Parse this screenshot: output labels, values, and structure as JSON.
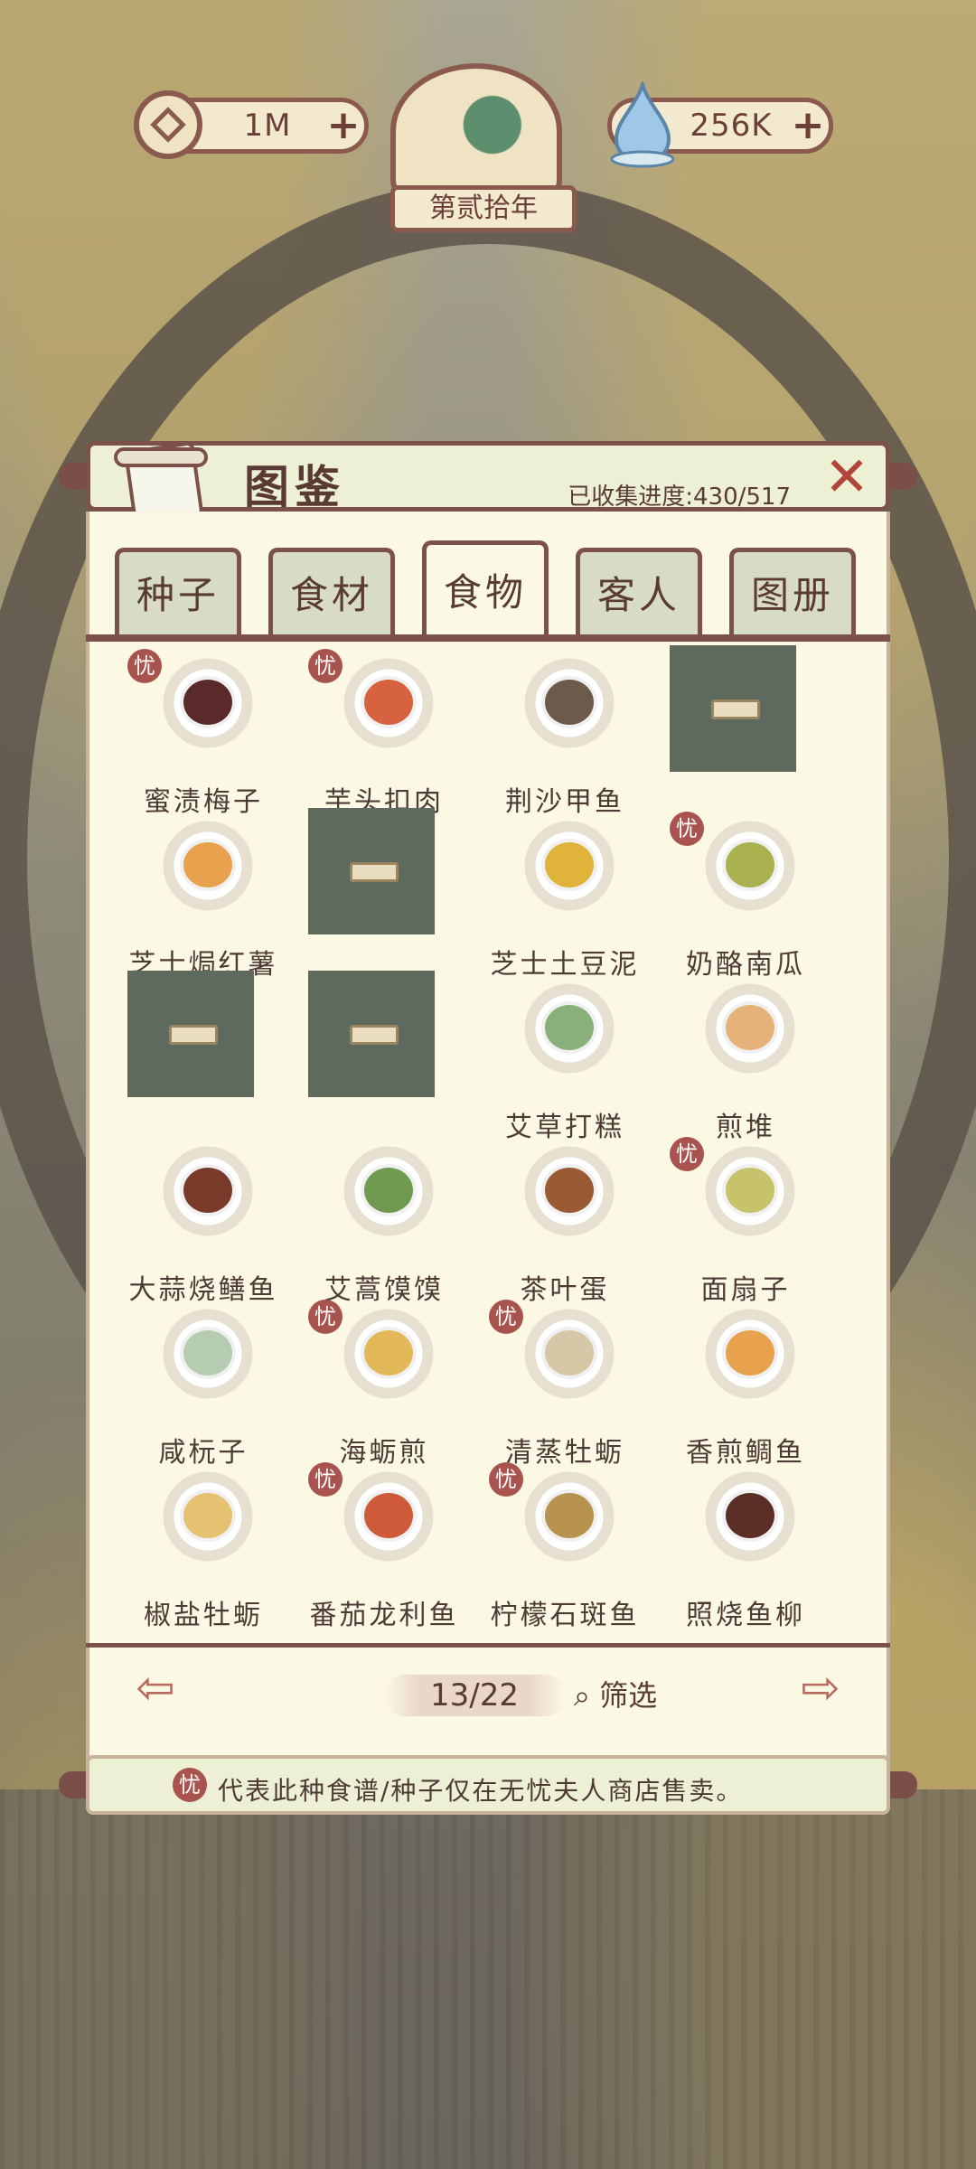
{
  "top": {
    "coins": "1M",
    "water": "256K",
    "year": "第贰拾年"
  },
  "panel": {
    "title": "图鉴",
    "progress": "已收集进度:430/517",
    "close_label": "✕"
  },
  "tabs": [
    {
      "label": "种子",
      "active": false
    },
    {
      "label": "食材",
      "active": false
    },
    {
      "label": "食物",
      "active": true
    },
    {
      "label": "客人",
      "active": false
    },
    {
      "label": "图册",
      "active": false
    }
  ],
  "badge_char": "忧",
  "items": [
    {
      "name": "蜜渍梅子",
      "locked": false,
      "badge": true,
      "color": "#5a2a2a"
    },
    {
      "name": "芋头扣肉",
      "locked": false,
      "badge": true,
      "color": "#d6623f"
    },
    {
      "name": "荆沙甲鱼",
      "locked": false,
      "badge": false,
      "color": "#6d5a4a"
    },
    {
      "name": "",
      "locked": true,
      "badge": false
    },
    {
      "name": "芝士焗红薯",
      "locked": false,
      "badge": false,
      "color": "#e8a24d"
    },
    {
      "name": "",
      "locked": true,
      "badge": false
    },
    {
      "name": "芝士土豆泥",
      "locked": false,
      "badge": false,
      "color": "#e0b43a"
    },
    {
      "name": "奶酪南瓜",
      "locked": false,
      "badge": true,
      "color": "#a9b24e"
    },
    {
      "name": "",
      "locked": true,
      "badge": false
    },
    {
      "name": "",
      "locked": true,
      "badge": false
    },
    {
      "name": "艾草打糕",
      "locked": false,
      "badge": false,
      "color": "#89b07a"
    },
    {
      "name": "煎堆",
      "locked": false,
      "badge": false,
      "color": "#e7b27a"
    },
    {
      "name": "大蒜烧鳝鱼",
      "locked": false,
      "badge": false,
      "color": "#7a3a2a"
    },
    {
      "name": "艾蒿馍馍",
      "locked": false,
      "badge": false,
      "color": "#6f9a4f"
    },
    {
      "name": "茶叶蛋",
      "locked": false,
      "badge": false,
      "color": "#9a5a34"
    },
    {
      "name": "面扇子",
      "locked": false,
      "badge": true,
      "color": "#c7c36a"
    },
    {
      "name": "咸杬子",
      "locked": false,
      "badge": false,
      "color": "#b6ccb0"
    },
    {
      "name": "海蛎煎",
      "locked": false,
      "badge": true,
      "color": "#e3b858"
    },
    {
      "name": "清蒸牡蛎",
      "locked": false,
      "badge": true,
      "color": "#d7c7a6"
    },
    {
      "name": "香煎鲷鱼",
      "locked": false,
      "badge": false,
      "color": "#e8a24d"
    },
    {
      "name": "椒盐牡蛎",
      "locked": false,
      "badge": false,
      "color": "#e6c172"
    },
    {
      "name": "番茄龙利鱼",
      "locked": false,
      "badge": true,
      "color": "#cf5a3a"
    },
    {
      "name": "柠檬石斑鱼",
      "locked": false,
      "badge": true,
      "color": "#b7934f"
    },
    {
      "name": "照烧鱼柳",
      "locked": false,
      "badge": false,
      "color": "#5c2f26"
    }
  ],
  "pagination": {
    "current": "13/22",
    "filter": "筛选",
    "prev": "⇦",
    "next": "⇨"
  },
  "footer_notice": "代表此种食谱/种子仅在无忧夫人商店售卖。",
  "colors": {
    "panel_border": "#7c5149",
    "badge": "#a8534d",
    "paper": "#fbf8e4"
  }
}
